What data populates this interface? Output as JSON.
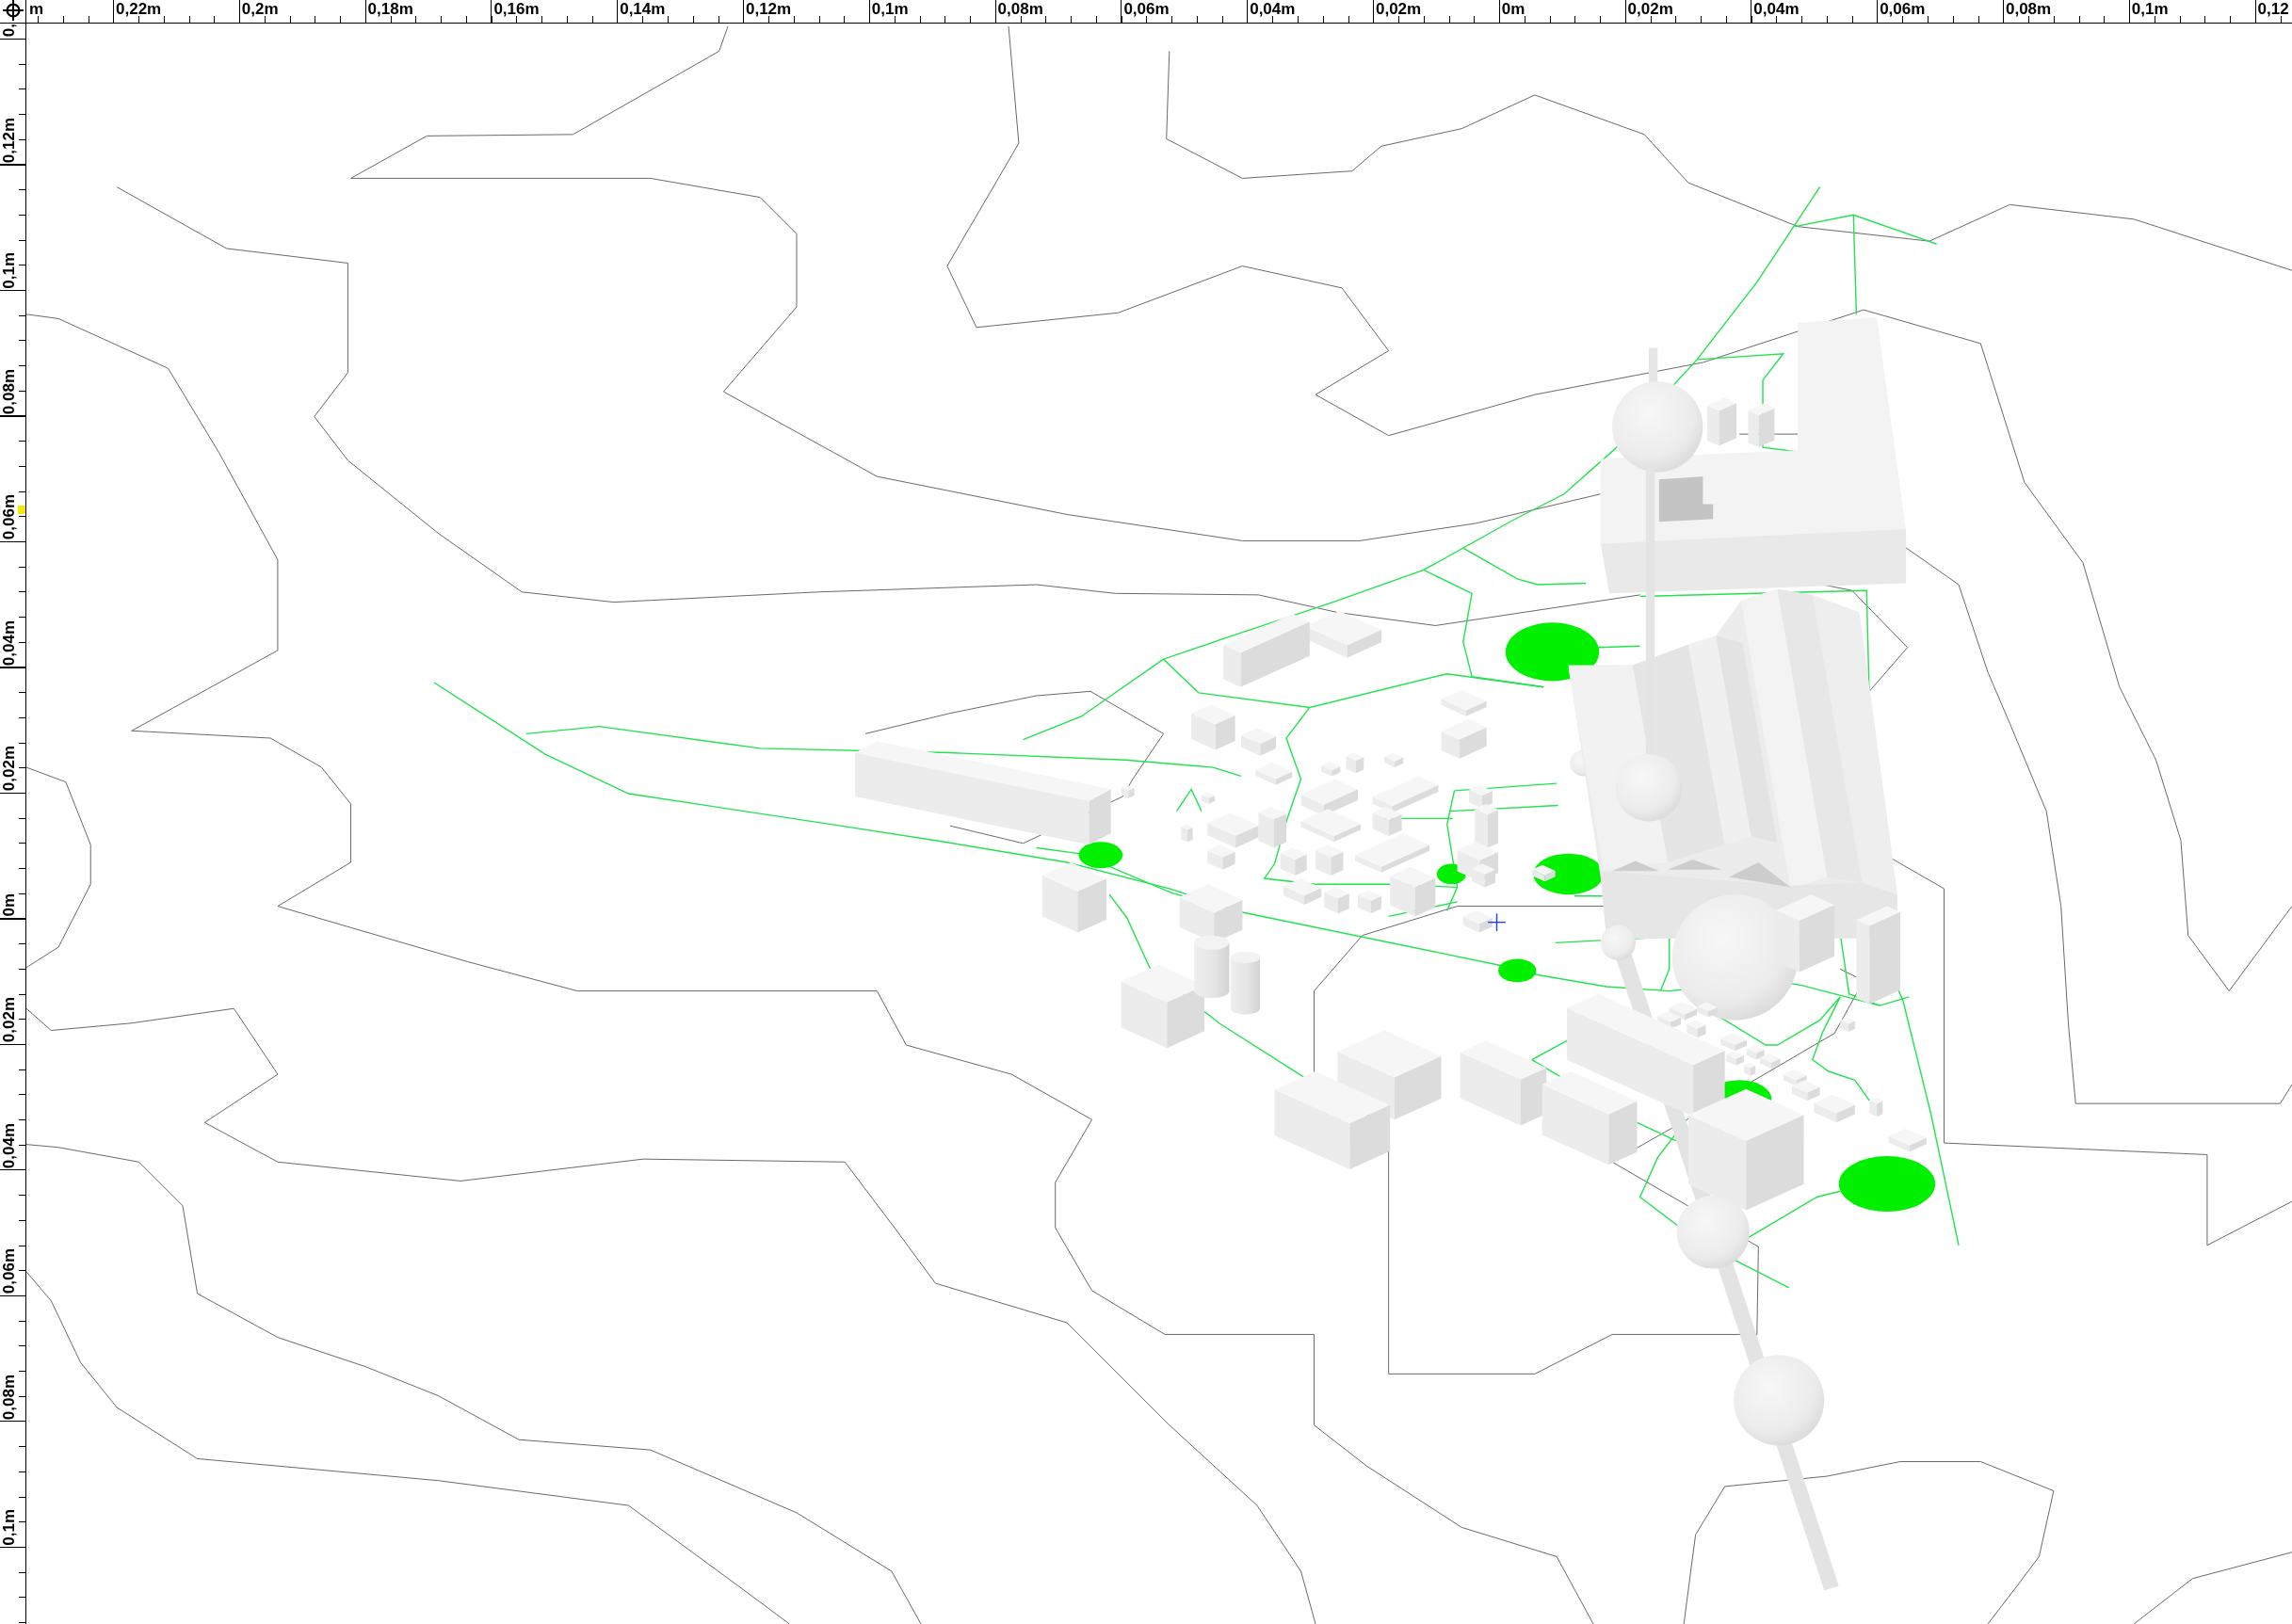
{
  "rulers": {
    "horizontal": {
      "labels": [
        "m",
        "0,22m",
        "0,2m",
        "0,18m",
        "0,16m",
        "0,14m",
        "0,12m",
        "0,1m",
        "0,08m",
        "0,06m",
        "0,04m",
        "0,02m",
        "0m",
        "0,02m",
        "0,04m",
        "0,06m",
        "0,08m",
        "0,1m",
        "0,12"
      ]
    },
    "vertical": {
      "labels": [
        "0,",
        "0,12m",
        "0,1m",
        "0,08m",
        "0,06m",
        "0,04m",
        "0,02m",
        "0m",
        "0,02m",
        "0,04m",
        "0,06m",
        "0,08m",
        "0,1m"
      ]
    }
  }
}
